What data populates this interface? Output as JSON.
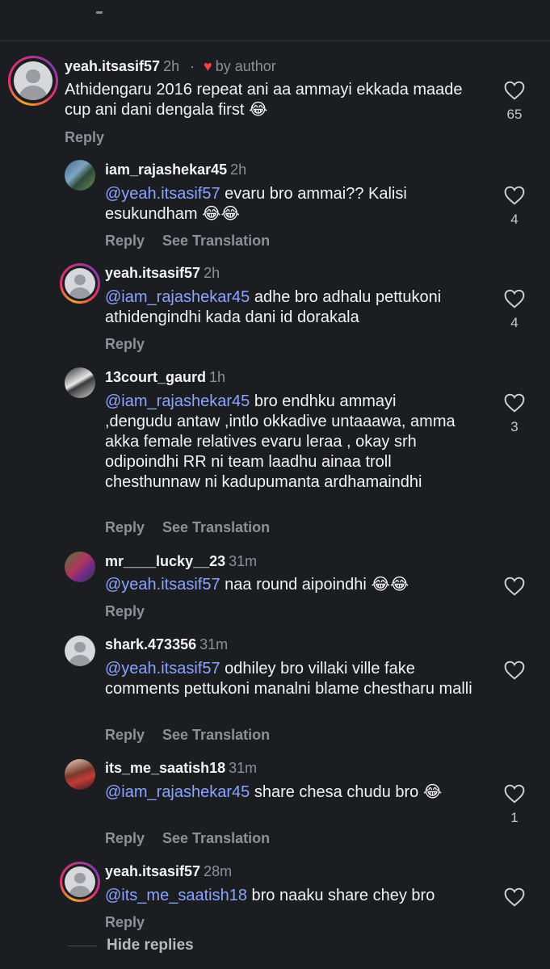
{
  "emoji": "😂",
  "comments": [
    {
      "username": "yeah.itsasif57",
      "time": "2h",
      "author_note": "by author",
      "text_before": "Athidengaru 2016 repeat ani aa ammayi ekkada maade cup ani dani dengala first",
      "mention": "",
      "text_after": "",
      "emoji_count": 1,
      "actions": [
        "Reply"
      ],
      "likes": "65"
    },
    {
      "username": "iam_rajashekar45",
      "time": "2h",
      "mention": "@yeah.itsasif57",
      "text_after": " evaru bro ammai?? Kalisi esukundham",
      "emoji_count": 2,
      "actions": [
        "Reply",
        "See Translation"
      ],
      "likes": "4"
    },
    {
      "username": "yeah.itsasif57",
      "time": "2h",
      "mention": "@iam_rajashekar45",
      "text_after": " adhe bro adhalu pettukoni athidengindhi kada dani id dorakala",
      "emoji_count": 0,
      "actions": [
        "Reply"
      ],
      "likes": "4"
    },
    {
      "username": "13court_gaurd",
      "time": "1h",
      "mention": "@iam_rajashekar45",
      "text_after": " bro endhku ammayi ,dengudu antaw ,intlo okkadive untaaawa, amma akka female relatives evaru leraa , okay srh odipoindhi RR ni team laadhu ainaa troll chesthunnaw ni kadupumanta ardhamaindhi",
      "emoji_count": 0,
      "actions": [
        "Reply",
        "See Translation"
      ],
      "likes": "3"
    },
    {
      "username": "mr____lucky__23",
      "time": "31m",
      "mention": "@yeah.itsasif57",
      "text_after": " naa round aipoindhi",
      "emoji_count": 2,
      "actions": [
        "Reply"
      ],
      "likes": ""
    },
    {
      "username": "shark.473356",
      "time": "31m",
      "mention": "@yeah.itsasif57",
      "text_after": " odhiley bro villaki ville fake comments pettukoni manalni blame chestharu malli",
      "emoji_count": 0,
      "actions": [
        "Reply",
        "See Translation"
      ],
      "likes": ""
    },
    {
      "username": "its_me_saatish18",
      "time": "31m",
      "mention": "@iam_rajashekar45",
      "text_after": " share chesa chudu bro",
      "emoji_count": 1,
      "actions": [
        "Reply",
        "See Translation"
      ],
      "likes": "1"
    },
    {
      "username": "yeah.itsasif57",
      "time": "28m",
      "mention": "@its_me_saatish18",
      "text_after": " bro naaku share chey bro",
      "emoji_count": 0,
      "actions": [
        "Reply"
      ],
      "likes": ""
    }
  ],
  "hide_replies": "Hide replies",
  "colors": {
    "background": "#1c1d21",
    "mention": "#8aa4ff",
    "heart": "#ff3b47",
    "muted": "#8e9096"
  },
  "icons": {
    "like": "heart-outline-icon",
    "author_like": "heart-filled-icon"
  }
}
